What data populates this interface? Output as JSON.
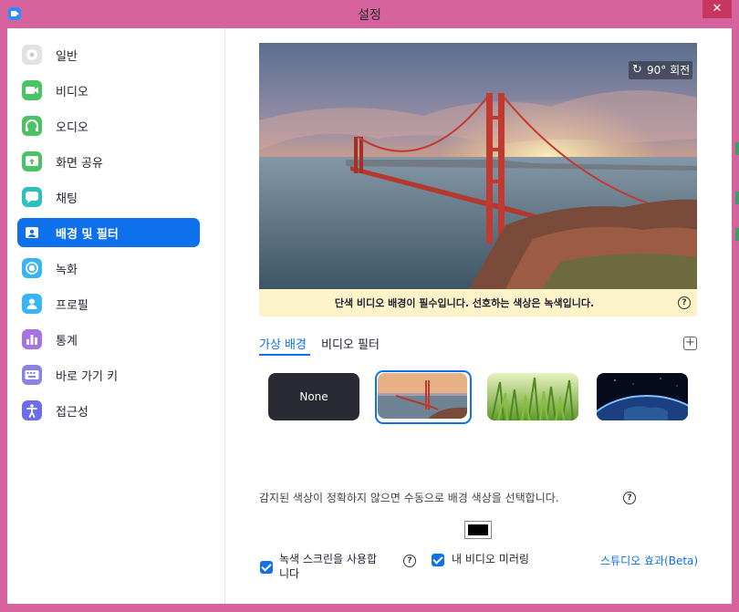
{
  "window": {
    "title": "설정",
    "close_label": "✕"
  },
  "sidebar": {
    "items": [
      {
        "label": "일반",
        "icon": "gear-icon",
        "color": "#dcdcdc"
      },
      {
        "label": "비디오",
        "icon": "video-icon",
        "color": "#4cc363"
      },
      {
        "label": "오디오",
        "icon": "headphones-icon",
        "color": "#4cc363"
      },
      {
        "label": "화면 공유",
        "icon": "share-screen-icon",
        "color": "#4cc363"
      },
      {
        "label": "채팅",
        "icon": "chat-icon",
        "color": "#2cc1bb"
      },
      {
        "label": "배경 및 필터",
        "icon": "background-icon",
        "color": "#0e71eb",
        "active": true
      },
      {
        "label": "녹화",
        "icon": "record-icon",
        "color": "#38b5f3"
      },
      {
        "label": "프로필",
        "icon": "profile-icon",
        "color": "#38b5f3"
      },
      {
        "label": "통계",
        "icon": "stats-icon",
        "color": "#a673e3"
      },
      {
        "label": "바로 가기 키",
        "icon": "keyboard-icon",
        "color": "#8a83e0"
      },
      {
        "label": "접근성",
        "icon": "accessibility-icon",
        "color": "#6b6ee8"
      }
    ]
  },
  "preview": {
    "rotate_label": "90° 회전",
    "notice": "단색 비디오 배경이 필수입니다. 선호하는 색상은 녹색입니다."
  },
  "tabs": [
    {
      "label": "가상 배경",
      "active": true
    },
    {
      "label": "비디오 필터",
      "active": false
    }
  ],
  "backgrounds": [
    {
      "label": "None"
    },
    {
      "name": "golden-gate",
      "selected": true
    },
    {
      "name": "grass"
    },
    {
      "name": "earth"
    }
  ],
  "hint": "감지된 색상이 정확하지 않으면 수동으로 배경 색상을 선택합니다.",
  "options": {
    "green_screen": {
      "label_line1": "녹색 스크린을 사용합",
      "label_line2": "니다",
      "checked": true
    },
    "mirror": {
      "label": "내 비디오 미러링",
      "checked": true
    },
    "studio_effects": "스튜디오 효과(Beta)"
  },
  "colors": {
    "accent": "#0e71eb",
    "frame": "#d6639d",
    "swatch": "#000000"
  }
}
